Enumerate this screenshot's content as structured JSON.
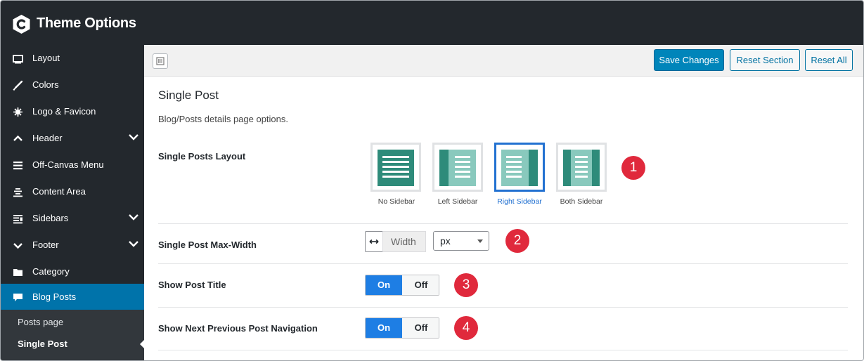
{
  "app": {
    "title": "Theme Options",
    "logo_icon": "theme-logo-icon"
  },
  "sidebar": {
    "items": [
      {
        "label": "Layout",
        "icon": "monitor-icon",
        "has_chevron": false
      },
      {
        "label": "Colors",
        "icon": "brush-icon",
        "has_chevron": false
      },
      {
        "label": "Logo & Favicon",
        "icon": "sparkle-icon",
        "has_chevron": false
      },
      {
        "label": "Header",
        "icon": "chevron-up-icon",
        "has_chevron": true
      },
      {
        "label": "Off-Canvas Menu",
        "icon": "menu-icon",
        "has_chevron": false
      },
      {
        "label": "Content Area",
        "icon": "align-center-icon",
        "has_chevron": false
      },
      {
        "label": "Sidebars",
        "icon": "sidebar-icon",
        "has_chevron": true
      },
      {
        "label": "Footer",
        "icon": "chevron-down-icon",
        "has_chevron": true
      },
      {
        "label": "Category",
        "icon": "folder-icon",
        "has_chevron": false
      },
      {
        "label": "Blog Posts",
        "icon": "comment-icon",
        "has_chevron": false,
        "active": true
      }
    ],
    "subitems": [
      {
        "label": "Posts page"
      },
      {
        "label": "Single Post",
        "current": true
      }
    ]
  },
  "toolbar": {
    "save_label": "Save Changes",
    "reset_section_label": "Reset Section",
    "reset_all_label": "Reset All"
  },
  "section": {
    "title": "Single Post",
    "description": "Blog/Posts details page options."
  },
  "fields": {
    "layout": {
      "label": "Single Posts Layout",
      "options": [
        {
          "caption": "No Sidebar"
        },
        {
          "caption": "Left Sidebar"
        },
        {
          "caption": "Right Sidebar"
        },
        {
          "caption": "Both Sidebar"
        }
      ],
      "selected": "Right Sidebar",
      "badge": "1"
    },
    "max_width": {
      "label": "Single Post Max-Width",
      "placeholder": "Width",
      "unit": "px",
      "badge": "2"
    },
    "show_title": {
      "label": "Show Post Title",
      "on_label": "On",
      "off_label": "Off",
      "badge": "3"
    },
    "post_nav": {
      "label": "Show Next Previous Post Navigation",
      "on_label": "On",
      "off_label": "Off",
      "badge": "4"
    }
  },
  "colors": {
    "topbar": "#23282d",
    "active_nav": "#0073aa",
    "primary_button": "#0085ba",
    "toggle_on": "#1e7ee4",
    "selected_layout": "#2271d1",
    "badge": "#e0293c",
    "layout_dark": "#2e8b7a",
    "layout_light": "#89c9bd"
  }
}
